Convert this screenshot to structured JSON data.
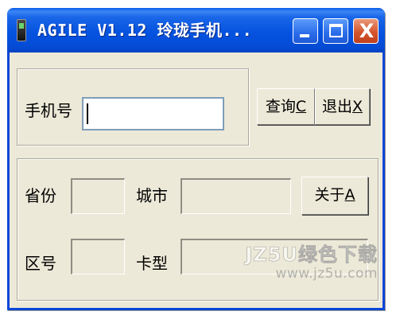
{
  "window": {
    "title": "AGILE V1.12 玲珑手机..."
  },
  "title_buttons": {
    "close_glyph": "X"
  },
  "query_group": {
    "phone_label": "手机号",
    "phone_value": "",
    "query_button_text": "查询",
    "query_button_key": "C",
    "exit_button_text": "退出",
    "exit_button_key": "X"
  },
  "result_group": {
    "province_label": "省份",
    "province_value": "",
    "city_label": "城市",
    "city_value": "",
    "about_button_text": "关于",
    "about_button_key": "A",
    "area_code_label": "区号",
    "area_code_value": "",
    "card_type_label": "卡型",
    "card_type_value": ""
  },
  "watermark": {
    "line1": "JZ5U绿色下载",
    "line2": "www.jz5u.com"
  },
  "icons": [
    "phone-app-icon",
    "minimize-icon",
    "maximize-icon",
    "close-icon"
  ],
  "colors": {
    "titlebar": "#0553e0",
    "window_bg": "#ece9d8",
    "close_button": "#d5552d"
  }
}
